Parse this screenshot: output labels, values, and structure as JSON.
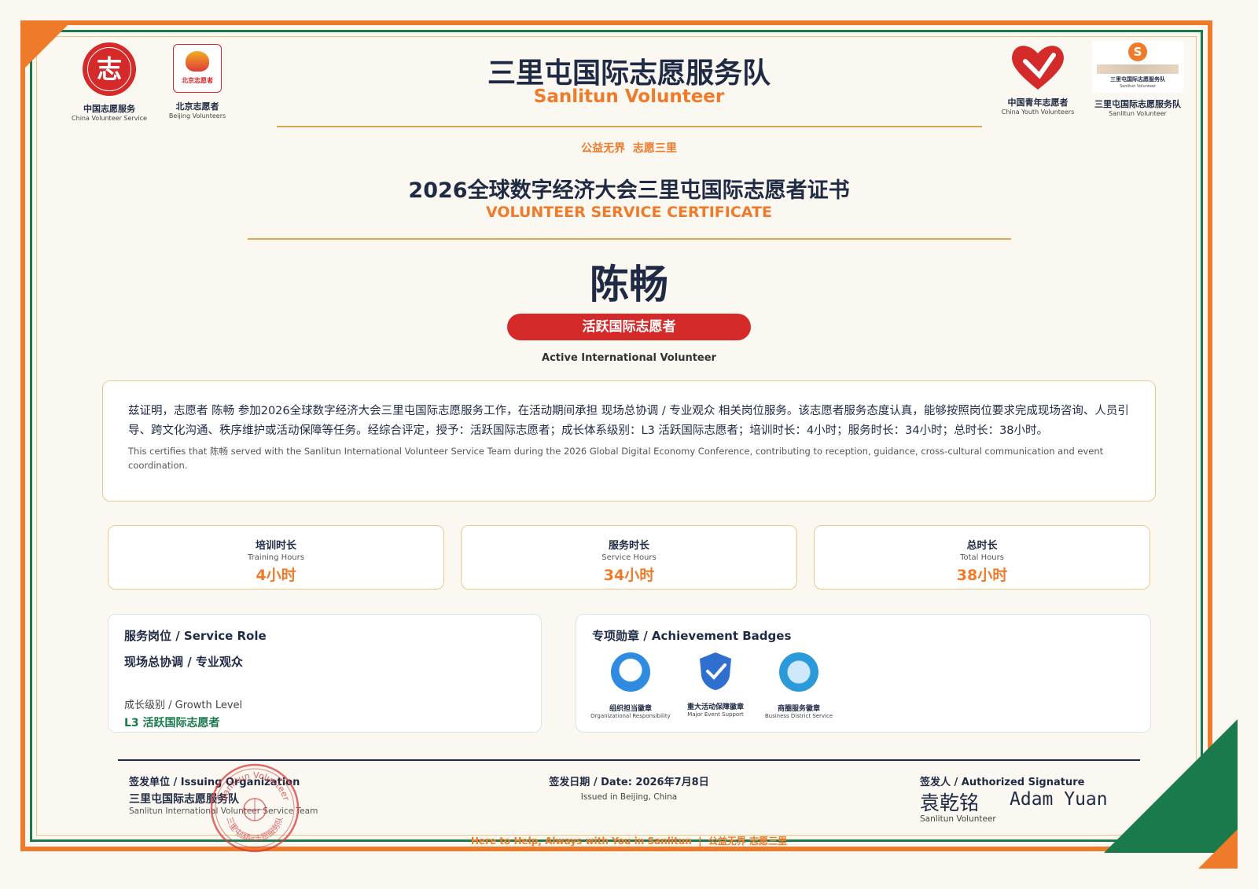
{
  "header": {
    "title_cn": "三里屯国际志愿服务队",
    "title_en": "Sanlitun Volunteer",
    "slogan": "公益无界  志愿三里",
    "cert_title_cn": "2026全球数字经济大会三里屯国际志愿者证书",
    "cert_title_en": "VOLUNTEER SERVICE CERTIFICATE"
  },
  "logos": {
    "china": {
      "seal_text": "志",
      "cap": "中国志愿服务",
      "sub": "China Volunteer Service"
    },
    "beijing": {
      "inner": "北京志愿者",
      "cap": "北京志愿者",
      "sub": "Beijing Volunteers"
    },
    "youth": {
      "cap": "中国青年志愿者",
      "sub": "China Youth Volunteers"
    },
    "sanlitun": {
      "inner_cn": "三里屯国际志愿服务队",
      "inner_en": "Sanlitun Volunteer",
      "cap": "三里屯国际志愿服务队",
      "sub": "Sanlitun Volunteer"
    }
  },
  "recipient": {
    "name": "陈畅",
    "level_badge": "活跃国际志愿者",
    "level_en": "Active International Volunteer"
  },
  "body": {
    "cn": "兹证明，志愿者 陈畅 参加2026全球数字经济大会三里屯国际志愿服务工作，在活动期间承担 现场总协调 / 专业观众 相关岗位服务。该志愿者服务态度认真，能够按照岗位要求完成现场咨询、人员引导、跨文化沟通、秩序维护或活动保障等任务。经综合评定，授予：活跃国际志愿者；成长体系级别：L3 活跃国际志愿者；培训时长：4小时；服务时长：34小时；总时长：38小时。",
    "en": "This certifies that 陈畅 served with the Sanlitun International Volunteer Service Team during the 2026 Global Digital Economy Conference, contributing to reception, guidance, cross-cultural communication and event coordination."
  },
  "hours": [
    {
      "cn": "培训时长",
      "en": "Training Hours",
      "value": "4小时"
    },
    {
      "cn": "服务时长",
      "en": "Service Hours",
      "value": "34小时"
    },
    {
      "cn": "总时长",
      "en": "Total Hours",
      "value": "38小时"
    }
  ],
  "role": {
    "label": "服务岗位 / Service Role",
    "value": "现场总协调 / 专业观众",
    "growth_label": "成长级别 / Growth Level",
    "growth_value": "L3 活跃国际志愿者"
  },
  "badges": {
    "title": "专项勋章 / Achievement Badges",
    "items": [
      {
        "cn": "组织担当徽章",
        "en": "Organizational Responsibility"
      },
      {
        "cn": "重大活动保障徽章",
        "en": "Major Event Support"
      },
      {
        "cn": "商圈服务徽章",
        "en": "Business District Service"
      }
    ]
  },
  "footer": {
    "org_label": "签发单位 / Issuing Organization",
    "org_cn": "三里屯国际志愿服务队",
    "org_en": "Sanlitun International Volunteer Service Team",
    "date_label": "签发日期 / Date: 2026年7月8日",
    "date_sub": "Issued in Beijing, China",
    "sign_label": "签发人 / Authorized Signature",
    "sign_cn": "袁乾铭",
    "sign_en": "Adam Yuan",
    "sign_sub": "Sanlitun Volunteer",
    "tagline": "Here to Help, Always with You in Sanlitun  |  公益无界 志愿三里",
    "stamp_top": "Sanlitun Volunteer",
    "stamp_bottom": "三里屯国际志愿服务队"
  },
  "colors": {
    "orange": "#ef7a2a",
    "green": "#1a7a4c",
    "red": "#d42a2a",
    "navy": "#1f2a44",
    "gold": "#d9a84a"
  }
}
